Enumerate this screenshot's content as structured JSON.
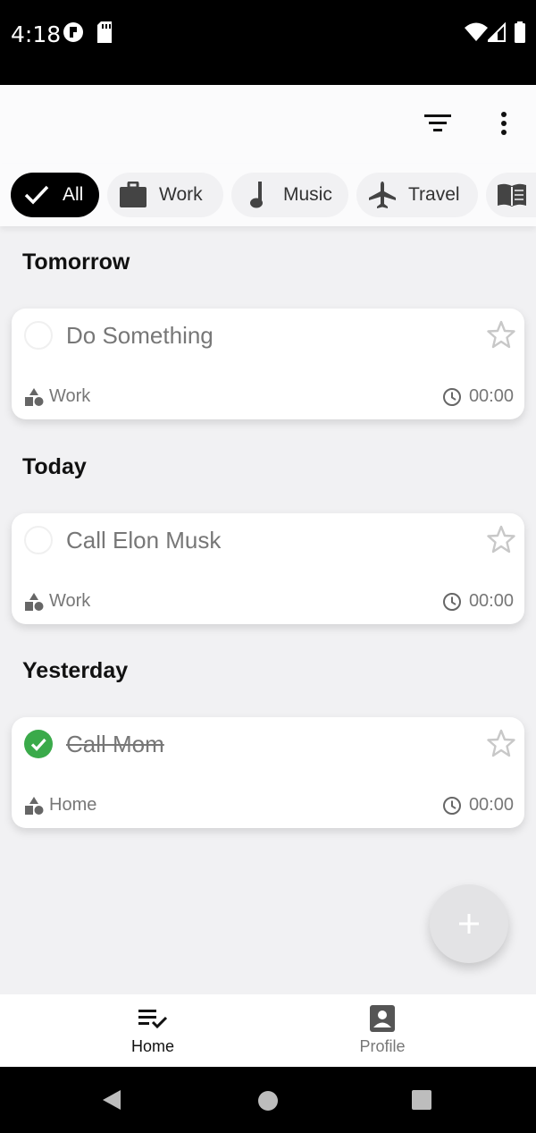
{
  "status_bar": {
    "time": "4:18"
  },
  "filters": [
    {
      "label": "All",
      "icon": "check-icon",
      "active": true
    },
    {
      "label": "Work",
      "icon": "briefcase-icon",
      "active": false
    },
    {
      "label": "Music",
      "icon": "music-note-icon",
      "active": false
    },
    {
      "label": "Travel",
      "icon": "airplane-icon",
      "active": false
    },
    {
      "label": "",
      "icon": "book-icon",
      "active": false
    }
  ],
  "sections": [
    {
      "title": "Tomorrow",
      "tasks": [
        {
          "title": "Do Something",
          "category": "Work",
          "time": "00:00",
          "done": false
        }
      ]
    },
    {
      "title": "Today",
      "tasks": [
        {
          "title": "Call Elon Musk",
          "category": "Work",
          "time": "00:00",
          "done": false
        }
      ]
    },
    {
      "title": "Yesterday",
      "tasks": [
        {
          "title": "Call Mom",
          "category": "Home",
          "time": "00:00",
          "done": true
        }
      ]
    }
  ],
  "bottom_nav": {
    "home_label": "Home",
    "profile_label": "Profile"
  },
  "colors": {
    "accent": "#000000",
    "done_green": "#3aaa4a",
    "muted_text": "#777777"
  }
}
